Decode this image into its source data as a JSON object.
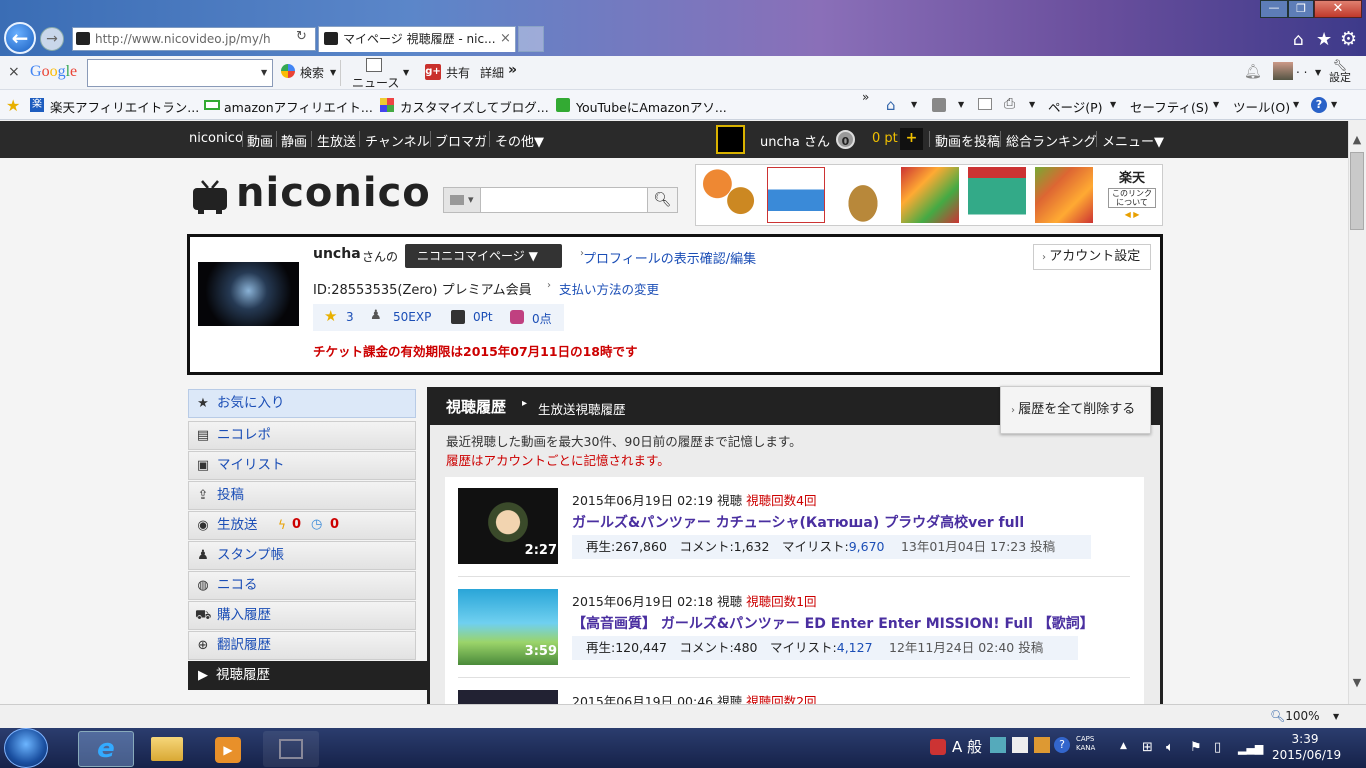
{
  "browser": {
    "url": "http://www.nicovideo.jp/my/h",
    "tab_title": "マイページ 視聴履歴 - nic...",
    "tab_close": "×",
    "min": "—",
    "max": "❐",
    "close": "✕"
  },
  "google_toolbar": {
    "close": "×",
    "logo": "Google",
    "search_value": "",
    "search_label": "検索",
    "news_label": "ニュース",
    "share_label": "共有",
    "detail_label": "詳細",
    "more": "»",
    "settings_label": "設定",
    "profile_dots": ". ."
  },
  "favorites": [
    {
      "label": "楽天アフィリエイトラン..."
    },
    {
      "label": "amazonアフィリエイト..."
    },
    {
      "label": "カスタマイズしてブログ..."
    },
    {
      "label": "YouTubeにAmazonアソ..."
    }
  ],
  "command_bar": {
    "more": "»",
    "page": "ページ(P)",
    "safety": "セーフティ(S)",
    "tools": "ツール(O)"
  },
  "nico_nav": {
    "items": [
      "niconico",
      "動画",
      "静画",
      "生放送",
      "チャンネル",
      "ブロマガ",
      "その他▼"
    ],
    "user": "uncha さん",
    "points_badge": "0",
    "points": "0 pt",
    "plus": "+",
    "right": [
      "動画を投稿",
      "総合ランキング",
      "メニュー▼"
    ]
  },
  "logo": {
    "text": "niconico"
  },
  "search": {
    "placeholder": "",
    "select": "▾"
  },
  "ads": {
    "rakuten_label": "楽天",
    "rakuten_sub": "このリンクについて"
  },
  "profile": {
    "name": "uncha",
    "san": "さんの",
    "mypage_button": "ニコニコマイページ ▼",
    "profile_link": "プロフィールの表示確認/編集",
    "account_button": "アカウント設定",
    "id_line": "ID:28553535(Zero) プレミアム会員",
    "payment_link": "支払い方法の変更",
    "stats": {
      "stars": "3",
      "exp": "50EXP",
      "pt": "0Pt",
      "score": "0点"
    },
    "ticket_notice": "チケット課金の有効期限は2015年07月11日の18時です"
  },
  "side_menu": [
    {
      "label": "お気に入り",
      "icon": "star-icon"
    },
    {
      "label": "ニコレポ",
      "icon": "report-icon"
    },
    {
      "label": "マイリスト",
      "icon": "mylist-icon"
    },
    {
      "label": "投稿",
      "icon": "upload-icon"
    },
    {
      "label": "生放送",
      "icon": "live-icon",
      "count1": "0",
      "count2": "0"
    },
    {
      "label": "スタンプ帳",
      "icon": "stamp-icon"
    },
    {
      "label": "ニコる",
      "icon": "nicoru-icon"
    },
    {
      "label": "購入履歴",
      "icon": "cart-icon"
    },
    {
      "label": "翻訳履歴",
      "icon": "globe-icon"
    },
    {
      "label": "視聴履歴",
      "icon": "play-icon"
    }
  ],
  "history": {
    "title": "視聴履歴",
    "live_link": "生放送視聴履歴",
    "delete_button": "履歴を全て削除する",
    "desc1": "最近視聴した動画を最大30件、90日前の履歴まで記憶します。",
    "desc2": "履歴はアカウントごとに記憶されます。",
    "items": [
      {
        "watched": "2015年06月19日 02:19 視聴",
        "count": "視聴回数4回",
        "title": "ガールズ&パンツァー カチューシャ(Катюша) プラウダ高校ver full",
        "duration": "2:27",
        "views_label": "再生:",
        "views": "267,860",
        "comments_label": "コメント:",
        "comments": "1,632",
        "mylist_label": "マイリスト:",
        "mylist": "9,670",
        "posted": "13年01月04日 17:23 投稿"
      },
      {
        "watched": "2015年06月19日 02:18 視聴",
        "count": "視聴回数1回",
        "title": "【高音画質】 ガールズ&パンツァー ED Enter Enter MISSION! Full 【歌詞】",
        "duration": "3:59",
        "views_label": "再生:",
        "views": "120,447",
        "comments_label": "コメント:",
        "comments": "480",
        "mylist_label": "マイリスト:",
        "mylist": "4,127",
        "posted": "12年11月24日 02:40 投稿"
      },
      {
        "watched": "2015年06月19日 00:46 視聴",
        "count": "視聴回数2回"
      }
    ]
  },
  "statusbar": {
    "zoom": "100%"
  },
  "taskbar": {
    "time": "3:39",
    "date": "2015/06/19",
    "ime": "A 般",
    "caps": "CAPS",
    "kana": "KANA"
  }
}
